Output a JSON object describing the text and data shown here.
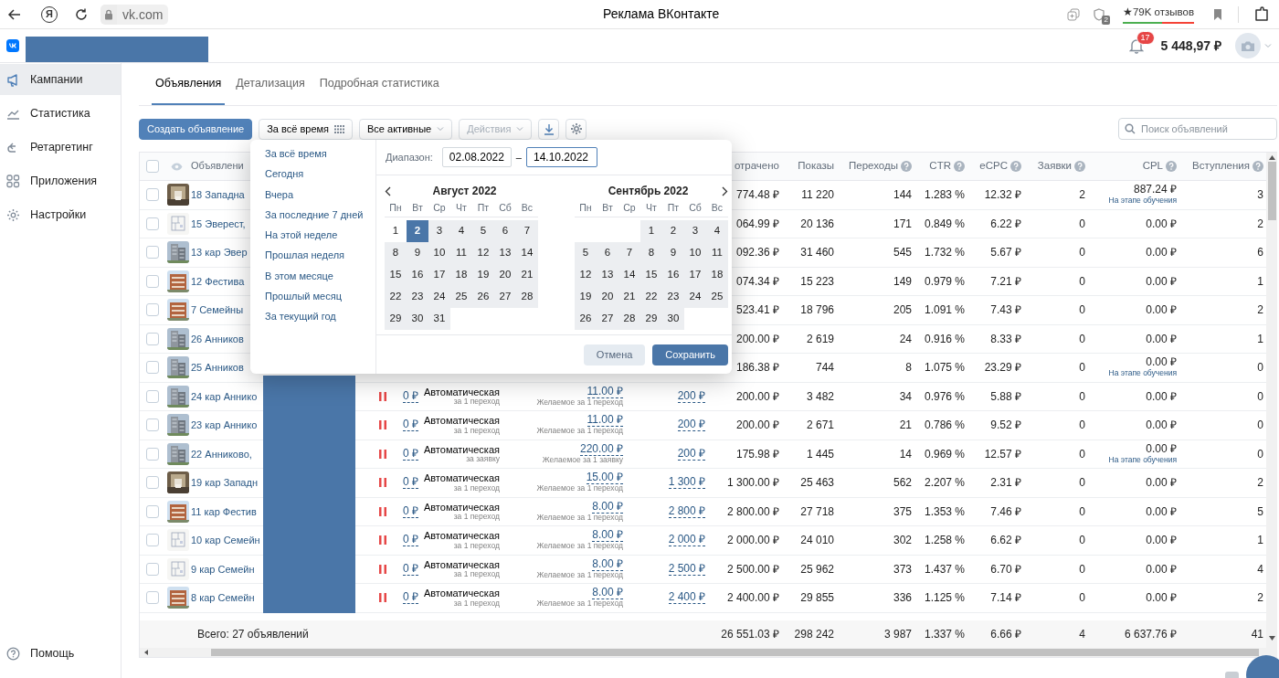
{
  "browser": {
    "logo_letter": "Я",
    "address": "vk.com",
    "title": "Реклама ВКонтакте",
    "shield_badge": "2",
    "reviews": "★79K отзывов"
  },
  "header": {
    "notifications": "17",
    "balance": "5 448,97 ₽"
  },
  "sidebar": {
    "items": [
      {
        "kind": "megaphone",
        "label": "Кампании",
        "selected": true
      },
      {
        "kind": "chart",
        "label": "Статистика",
        "selected": false
      },
      {
        "kind": "retarget",
        "label": "Ретаргетинг",
        "selected": false
      },
      {
        "kind": "apps",
        "label": "Приложения",
        "selected": false
      },
      {
        "kind": "settings",
        "label": "Настройки",
        "selected": false
      }
    ],
    "help": {
      "kind": "help",
      "label": "Помощь"
    }
  },
  "tabs": [
    {
      "label": "Объявления",
      "selected": true
    },
    {
      "label": "Детализация",
      "selected": false
    },
    {
      "label": "Подробная статистика",
      "selected": false
    }
  ],
  "toolbar": {
    "create": "Создать объявление",
    "period": "За всё время",
    "filter": "Все активные",
    "actions": {
      "label": "Действия",
      "disabled": true
    },
    "search_placeholder": "Поиск объявлений"
  },
  "table": {
    "header": {
      "checked": false,
      "name": "Объявлени",
      "metrics": [
        {
          "label": "отрачено",
          "help": false
        },
        {
          "label": "Показы",
          "help": false
        },
        {
          "label": "Переходы",
          "help": true
        },
        {
          "label": "CTR",
          "help": true
        },
        {
          "label": "eCPC",
          "help": true
        },
        {
          "label": "Заявки",
          "help": true
        },
        {
          "label": "CPL",
          "help": true
        },
        {
          "label": "Вступления",
          "help": true
        }
      ]
    },
    "rows": [
      {
        "checked": false,
        "thumb": {
          "kind": "picture"
        },
        "name": "18 Западна",
        "metrics": [
          "774.48 ₽",
          "11 220",
          "144",
          "1.283 %",
          "12.32 ₽",
          "2",
          "887.24 ₽",
          "3"
        ],
        "cpl_note": "На этапе обучения"
      },
      {
        "checked": false,
        "thumb": {
          "kind": "picture"
        },
        "name": "15 Эверест,",
        "metrics": [
          "064.99 ₽",
          "20 136",
          "171",
          "0.849 %",
          "6.22 ₽",
          "0",
          "0.00 ₽",
          "2"
        ]
      },
      {
        "checked": false,
        "thumb": {
          "kind": "picture"
        },
        "name": "13 кар Эвер",
        "metrics": [
          "092.36 ₽",
          "31 460",
          "545",
          "1.732 %",
          "5.67 ₽",
          "0",
          "0.00 ₽",
          "6"
        ]
      },
      {
        "checked": false,
        "thumb": {
          "kind": "picture"
        },
        "name": "12 Фестива",
        "metrics": [
          "074.34 ₽",
          "15 223",
          "149",
          "0.979 %",
          "7.21 ₽",
          "0",
          "0.00 ₽",
          "1"
        ]
      },
      {
        "checked": false,
        "thumb": {
          "kind": "picture"
        },
        "name": "7 Семейны",
        "metrics": [
          "523.41 ₽",
          "18 796",
          "205",
          "1.091 %",
          "7.43 ₽",
          "0",
          "0.00 ₽",
          "2"
        ]
      },
      {
        "checked": false,
        "thumb": {
          "kind": "picture"
        },
        "name": "26 Анников",
        "metrics": [
          "200.00 ₽",
          "2 619",
          "24",
          "0.916 %",
          "8.33 ₽",
          "0",
          "0.00 ₽",
          "1"
        ]
      },
      {
        "checked": false,
        "thumb": {
          "kind": "picture"
        },
        "name": "25 Анников",
        "metrics": [
          "186.38 ₽",
          "744",
          "8",
          "1.075 %",
          "23.29 ₽",
          "0",
          "0.00 ₽",
          "0"
        ],
        "cpl_note": "На этапе обучения"
      },
      {
        "checked": false,
        "thumb": {
          "kind": "picture"
        },
        "name": "24 кар Аннико",
        "paused": true,
        "budget": "0 ₽",
        "strategy": "Автоматическая",
        "strategy_note": "за 1 переход",
        "bid": "11.00 ₽",
        "bid_note": "Желаемое за 1 переход",
        "limit": "200 ₽",
        "metrics": [
          "200.00 ₽",
          "3 482",
          "34",
          "0.976 %",
          "5.88 ₽",
          "0",
          "0.00 ₽",
          "0"
        ]
      },
      {
        "checked": false,
        "thumb": {
          "kind": "picture"
        },
        "name": "23 кар Аннико",
        "paused": true,
        "budget": "0 ₽",
        "strategy": "Автоматическая",
        "strategy_note": "за 1 переход",
        "bid": "11.00 ₽",
        "bid_note": "Желаемое за 1 переход",
        "limit": "200 ₽",
        "metrics": [
          "200.00 ₽",
          "2 671",
          "21",
          "0.786 %",
          "9.52 ₽",
          "0",
          "0.00 ₽",
          "0"
        ]
      },
      {
        "checked": false,
        "thumb": {
          "kind": "picture"
        },
        "name": "22 Анниково,",
        "paused": true,
        "budget": "0 ₽",
        "strategy": "Автоматическая",
        "strategy_note": "за заявку",
        "bid": "220.00 ₽",
        "bid_note": "Желаемое за 1 заявку",
        "limit": "200 ₽",
        "metrics": [
          "175.98 ₽",
          "1 445",
          "14",
          "0.969 %",
          "12.57 ₽",
          "0",
          "0.00 ₽",
          "0"
        ],
        "cpl_note": "На этапе обучения"
      },
      {
        "checked": false,
        "thumb": {
          "kind": "picture"
        },
        "name": "19 кар Западн",
        "paused": true,
        "budget": "0 ₽",
        "strategy": "Автоматическая",
        "strategy_note": "за 1 переход",
        "bid": "15.00 ₽",
        "bid_note": "Желаемое за 1 переход",
        "limit": "1 300 ₽",
        "metrics": [
          "1 300.00 ₽",
          "25 463",
          "562",
          "2.207 %",
          "2.31 ₽",
          "0",
          "0.00 ₽",
          "2"
        ]
      },
      {
        "checked": false,
        "thumb": {
          "kind": "picture"
        },
        "name": "11 кар Фестив",
        "paused": true,
        "budget": "0 ₽",
        "strategy": "Автоматическая",
        "strategy_note": "за 1 переход",
        "bid": "8.00 ₽",
        "bid_note": "Желаемое за 1 переход",
        "limit": "2 800 ₽",
        "metrics": [
          "2 800.00 ₽",
          "27 718",
          "375",
          "1.353 %",
          "7.46 ₽",
          "0",
          "0.00 ₽",
          "5"
        ]
      },
      {
        "checked": false,
        "thumb": {
          "kind": "picture"
        },
        "name": "10 кар Семейн",
        "paused": true,
        "budget": "0 ₽",
        "strategy": "Автоматическая",
        "strategy_note": "за 1 переход",
        "bid": "8.00 ₽",
        "bid_note": "Желаемое за 1 переход",
        "limit": "2 000 ₽",
        "metrics": [
          "2 000.00 ₽",
          "24 010",
          "302",
          "1.258 %",
          "6.62 ₽",
          "0",
          "0.00 ₽",
          "1"
        ]
      },
      {
        "checked": false,
        "thumb": {
          "kind": "picture"
        },
        "name": "9 кар Семейн",
        "paused": true,
        "budget": "0 ₽",
        "strategy": "Автоматическая",
        "strategy_note": "за 1 переход",
        "bid": "8.00 ₽",
        "bid_note": "Желаемое за 1 переход",
        "limit": "2 500 ₽",
        "metrics": [
          "2 500.00 ₽",
          "25 962",
          "373",
          "1.437 %",
          "6.70 ₽",
          "0",
          "0.00 ₽",
          "4"
        ]
      },
      {
        "checked": false,
        "thumb": {
          "kind": "picture"
        },
        "name": "8 кар Семейн",
        "paused": true,
        "budget": "0 ₽",
        "strategy": "Автоматическая",
        "strategy_note": "за 1 переход",
        "bid": "8.00 ₽",
        "bid_note": "Желаемое за 1 переход",
        "limit": "2 400 ₽",
        "metrics": [
          "2 400.00 ₽",
          "29 855",
          "336",
          "1.125 %",
          "7.14 ₽",
          "0",
          "0.00 ₽",
          "2"
        ]
      }
    ],
    "totals": {
      "label": "Всего: 27 объявлений",
      "metrics": [
        "26 551.03 ₽",
        "298 242",
        "3 987",
        "1.337 %",
        "6.66 ₽",
        "4",
        "6 637.76 ₽",
        "41"
      ]
    }
  },
  "date_picker": {
    "presets": [
      "За всё время",
      "Сегодня",
      "Вчера",
      "За последние 7 дней",
      "На этой неделе",
      "Прошлая неделя",
      "В этом месяце",
      "Прошлый месяц",
      "За текущий год"
    ],
    "range_label": "Диапазон:",
    "from": {
      "value": "02.08.2022",
      "focused": false
    },
    "separator": "–",
    "to": {
      "value": "14.10.2022",
      "focused": true
    },
    "months": [
      {
        "prev_arrow": true,
        "next_arrow": false,
        "title": "Август 2022",
        "weekdays": [
          "Пн",
          "Вт",
          "Ср",
          "Чт",
          "Пт",
          "Сб",
          "Вс"
        ],
        "weeks": [
          [
            {
              "day": "1",
              "selected": false,
              "in_range": false
            },
            {
              "day": "2",
              "selected": true,
              "in_range": true
            },
            {
              "day": "3",
              "selected": false,
              "in_range": true
            },
            {
              "day": "4",
              "selected": false,
              "in_range": true
            },
            {
              "day": "5",
              "selected": false,
              "in_range": true
            },
            {
              "day": "6",
              "selected": false,
              "in_range": true
            },
            {
              "day": "7",
              "selected": false,
              "in_range": true
            }
          ],
          [
            {
              "day": "8",
              "selected": false,
              "in_range": true
            },
            {
              "day": "9",
              "selected": false,
              "in_range": true
            },
            {
              "day": "10",
              "selected": false,
              "in_range": true
            },
            {
              "day": "11",
              "selected": false,
              "in_range": true
            },
            {
              "day": "12",
              "selected": false,
              "in_range": true
            },
            {
              "day": "13",
              "selected": false,
              "in_range": true
            },
            {
              "day": "14",
              "selected": false,
              "in_range": true
            }
          ],
          [
            {
              "day": "15",
              "selected": false,
              "in_range": true
            },
            {
              "day": "16",
              "selected": false,
              "in_range": true
            },
            {
              "day": "17",
              "selected": false,
              "in_range": true
            },
            {
              "day": "18",
              "selected": false,
              "in_range": true
            },
            {
              "day": "19",
              "selected": false,
              "in_range": true
            },
            {
              "day": "20",
              "selected": false,
              "in_range": true
            },
            {
              "day": "21",
              "selected": false,
              "in_range": true
            }
          ],
          [
            {
              "day": "22",
              "selected": false,
              "in_range": true
            },
            {
              "day": "23",
              "selected": false,
              "in_range": true
            },
            {
              "day": "24",
              "selected": false,
              "in_range": true
            },
            {
              "day": "25",
              "selected": false,
              "in_range": true
            },
            {
              "day": "26",
              "selected": false,
              "in_range": true
            },
            {
              "day": "27",
              "selected": false,
              "in_range": true
            },
            {
              "day": "28",
              "selected": false,
              "in_range": true
            }
          ],
          [
            {
              "day": "29",
              "selected": false,
              "in_range": true
            },
            {
              "day": "30",
              "selected": false,
              "in_range": true
            },
            {
              "day": "31",
              "selected": false,
              "in_range": true
            }
          ]
        ]
      },
      {
        "prev_arrow": false,
        "next_arrow": true,
        "title": "Сентябрь 2022",
        "weekdays": [
          "Пн",
          "Вт",
          "Ср",
          "Чт",
          "Пт",
          "Сб",
          "Вс"
        ],
        "weeks": [
          [
            {
              "day": "1",
              "selected": false,
              "in_range": true
            },
            {
              "day": "2",
              "selected": false,
              "in_range": true
            },
            {
              "day": "3",
              "selected": false,
              "in_range": true
            },
            {
              "day": "4",
              "selected": false,
              "in_range": true
            }
          ],
          [
            {
              "day": "5",
              "selected": false,
              "in_range": true
            },
            {
              "day": "6",
              "selected": false,
              "in_range": true
            },
            {
              "day": "7",
              "selected": false,
              "in_range": true
            },
            {
              "day": "8",
              "selected": false,
              "in_range": true
            },
            {
              "day": "9",
              "selected": false,
              "in_range": true
            },
            {
              "day": "10",
              "selected": false,
              "in_range": true
            },
            {
              "day": "11",
              "selected": false,
              "in_range": true
            }
          ],
          [
            {
              "day": "12",
              "selected": false,
              "in_range": true
            },
            {
              "day": "13",
              "selected": false,
              "in_range": true
            },
            {
              "day": "14",
              "selected": false,
              "in_range": true
            },
            {
              "day": "15",
              "selected": false,
              "in_range": true
            },
            {
              "day": "16",
              "selected": false,
              "in_range": true
            },
            {
              "day": "17",
              "selected": false,
              "in_range": true
            },
            {
              "day": "18",
              "selected": false,
              "in_range": true
            }
          ],
          [
            {
              "day": "19",
              "selected": false,
              "in_range": true
            },
            {
              "day": "20",
              "selected": false,
              "in_range": true
            },
            {
              "day": "21",
              "selected": false,
              "in_range": true
            },
            {
              "day": "22",
              "selected": false,
              "in_range": true
            },
            {
              "day": "23",
              "selected": false,
              "in_range": true
            },
            {
              "day": "24",
              "selected": false,
              "in_range": true
            },
            {
              "day": "25",
              "selected": false,
              "in_range": true
            }
          ],
          [
            {
              "day": "26",
              "selected": false,
              "in_range": true
            },
            {
              "day": "27",
              "selected": false,
              "in_range": true
            },
            {
              "day": "28",
              "selected": false,
              "in_range": true
            },
            {
              "day": "29",
              "selected": false,
              "in_range": true
            },
            {
              "day": "30",
              "selected": false,
              "in_range": true
            }
          ]
        ]
      }
    ],
    "cancel": "Отмена",
    "save": "Сохранить"
  }
}
